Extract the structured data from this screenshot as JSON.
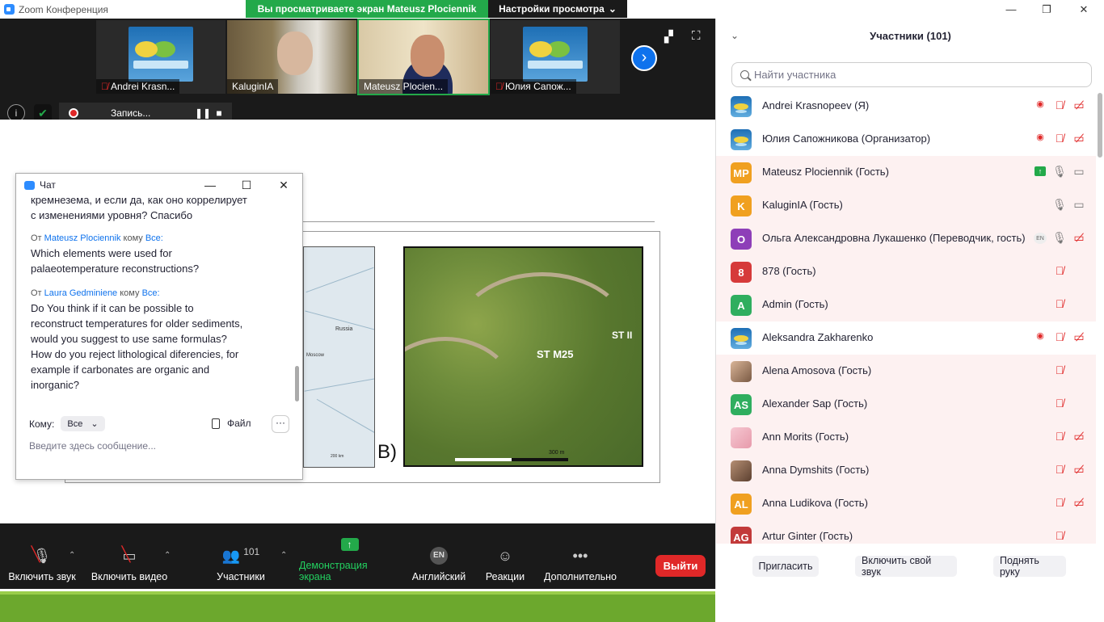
{
  "window": {
    "title": "Zoom Конференция",
    "minimize": "—",
    "restore": "❐",
    "close": "✕"
  },
  "share_banner": {
    "text": "Вы просматриваете экран Mateusz Plociennik",
    "view_settings": "Настройки просмотра"
  },
  "thumbnails": [
    {
      "name": "Andrei Krasn...",
      "muted": true
    },
    {
      "name": "KaluginIA",
      "muted": false
    },
    {
      "name": "Mateusz Plocien...",
      "muted": false
    },
    {
      "name": "Юлия Сапож...",
      "muted": true
    }
  ],
  "recording": {
    "label": "Запись..."
  },
  "slide": {
    "map_russia": "Russia",
    "map_moscow": "Moscow",
    "map_scale": "200 km",
    "panel_label": "B)",
    "site_m25": "ST M25",
    "site_st2": "ST II",
    "aerial_scale": "300 m"
  },
  "chat": {
    "title": "Чат",
    "messages": [
      {
        "text_lines": [
          "кремнезема, и если да, как оно коррелирует",
          "с изменениями уровня? Спасибо"
        ]
      },
      {
        "from_prefix": "От",
        "from": "Mateusz Plociennik",
        "to_prefix": "кому",
        "to": "Все:",
        "text_lines": [
          "Which elements were used for",
          "palaeotemperature reconstructions?"
        ]
      },
      {
        "from_prefix": "От",
        "from": "Laura Gedminiene",
        "to_prefix": "кому",
        "to": "Все:",
        "text_lines": [
          "Do You think if it can be possible to",
          "reconstruct  temperatures for older sediments,",
          "would you suggest to use same formulas?",
          "How do you reject lithological diferencies, for",
          "example if carbonates are organic and",
          "inorganic?"
        ]
      }
    ],
    "to_label": "Кому:",
    "to_value": "Все",
    "file_label": "Файл",
    "more": "···",
    "input_placeholder": "Введите здесь сообщение..."
  },
  "toolbar": {
    "audio": "Включить звук",
    "video": "Включить видео",
    "participants": "Участники",
    "participants_count": "101",
    "share": "Демонстрация экрана",
    "language": "Английский",
    "language_badge": "EN",
    "reactions": "Реакции",
    "more": "Дополнительно",
    "exit": "Выйти"
  },
  "panel": {
    "title": "Участники (101)",
    "search_placeholder": "Найти участника",
    "participants": [
      {
        "initials": "",
        "avatar": "logo",
        "color": "",
        "name": "Andrei Krasnopeev (Я)",
        "rec": true,
        "mic": "off",
        "cam": "off",
        "pink": false
      },
      {
        "initials": "",
        "avatar": "logo",
        "color": "",
        "name": "Юлия Сапожникова (Организатор)",
        "rec": true,
        "mic": "off",
        "cam": "off",
        "pink": false
      },
      {
        "initials": "MP",
        "avatar": "initials",
        "color": "#f0a020",
        "name": "Mateusz Plociennik (Гость)",
        "share": true,
        "mic": "on",
        "cam": "on",
        "pink": true
      },
      {
        "initials": "K",
        "avatar": "initials",
        "color": "#f0a020",
        "name": "KaluginIA (Гость)",
        "mic": "on",
        "cam": "on",
        "pink": true
      },
      {
        "initials": "О",
        "avatar": "initials",
        "color": "#8e3fb8",
        "name": "Ольга Александровна Лукашенко (Переводчик, гость)",
        "en": "EN",
        "mic": "on",
        "cam": "off",
        "pink": true
      },
      {
        "initials": "8",
        "avatar": "initials",
        "color": "#d63a3a",
        "name": "878 (Гость)",
        "mic": "off",
        "pink": true
      },
      {
        "initials": "A",
        "avatar": "initials",
        "color": "#2fae5f",
        "name": "Admin (Гость)",
        "mic": "off",
        "pink": true
      },
      {
        "initials": "",
        "avatar": "logo",
        "color": "",
        "name": "Aleksandra Zakharenko",
        "rec": true,
        "mic": "off",
        "cam": "off",
        "pink": false
      },
      {
        "initials": "",
        "avatar": "photo1",
        "color": "",
        "name": "Alena Amosova (Гость)",
        "mic": "off",
        "pink": true
      },
      {
        "initials": "AS",
        "avatar": "initials",
        "color": "#2fae5f",
        "name": "Alexander Sap (Гость)",
        "mic": "off",
        "pink": true
      },
      {
        "initials": "",
        "avatar": "photo2",
        "color": "",
        "name": "Ann Morits (Гость)",
        "mic": "off",
        "cam": "off",
        "pink": true
      },
      {
        "initials": "",
        "avatar": "photo3",
        "color": "",
        "name": "Anna Dymshits (Гость)",
        "mic": "off",
        "cam": "off",
        "pink": true
      },
      {
        "initials": "AL",
        "avatar": "initials",
        "color": "#f0a020",
        "name": "Anna Ludikova (Гость)",
        "mic": "off",
        "cam": "off",
        "pink": true
      },
      {
        "initials": "AG",
        "avatar": "initials",
        "color": "#c23a3a",
        "name": "Artur Ginter (Гость)",
        "mic": "off",
        "pink": true
      }
    ],
    "buttons": {
      "invite": "Пригласить",
      "unmute_me": "Включить свой звук",
      "raise_hand": "Поднять руку"
    }
  }
}
